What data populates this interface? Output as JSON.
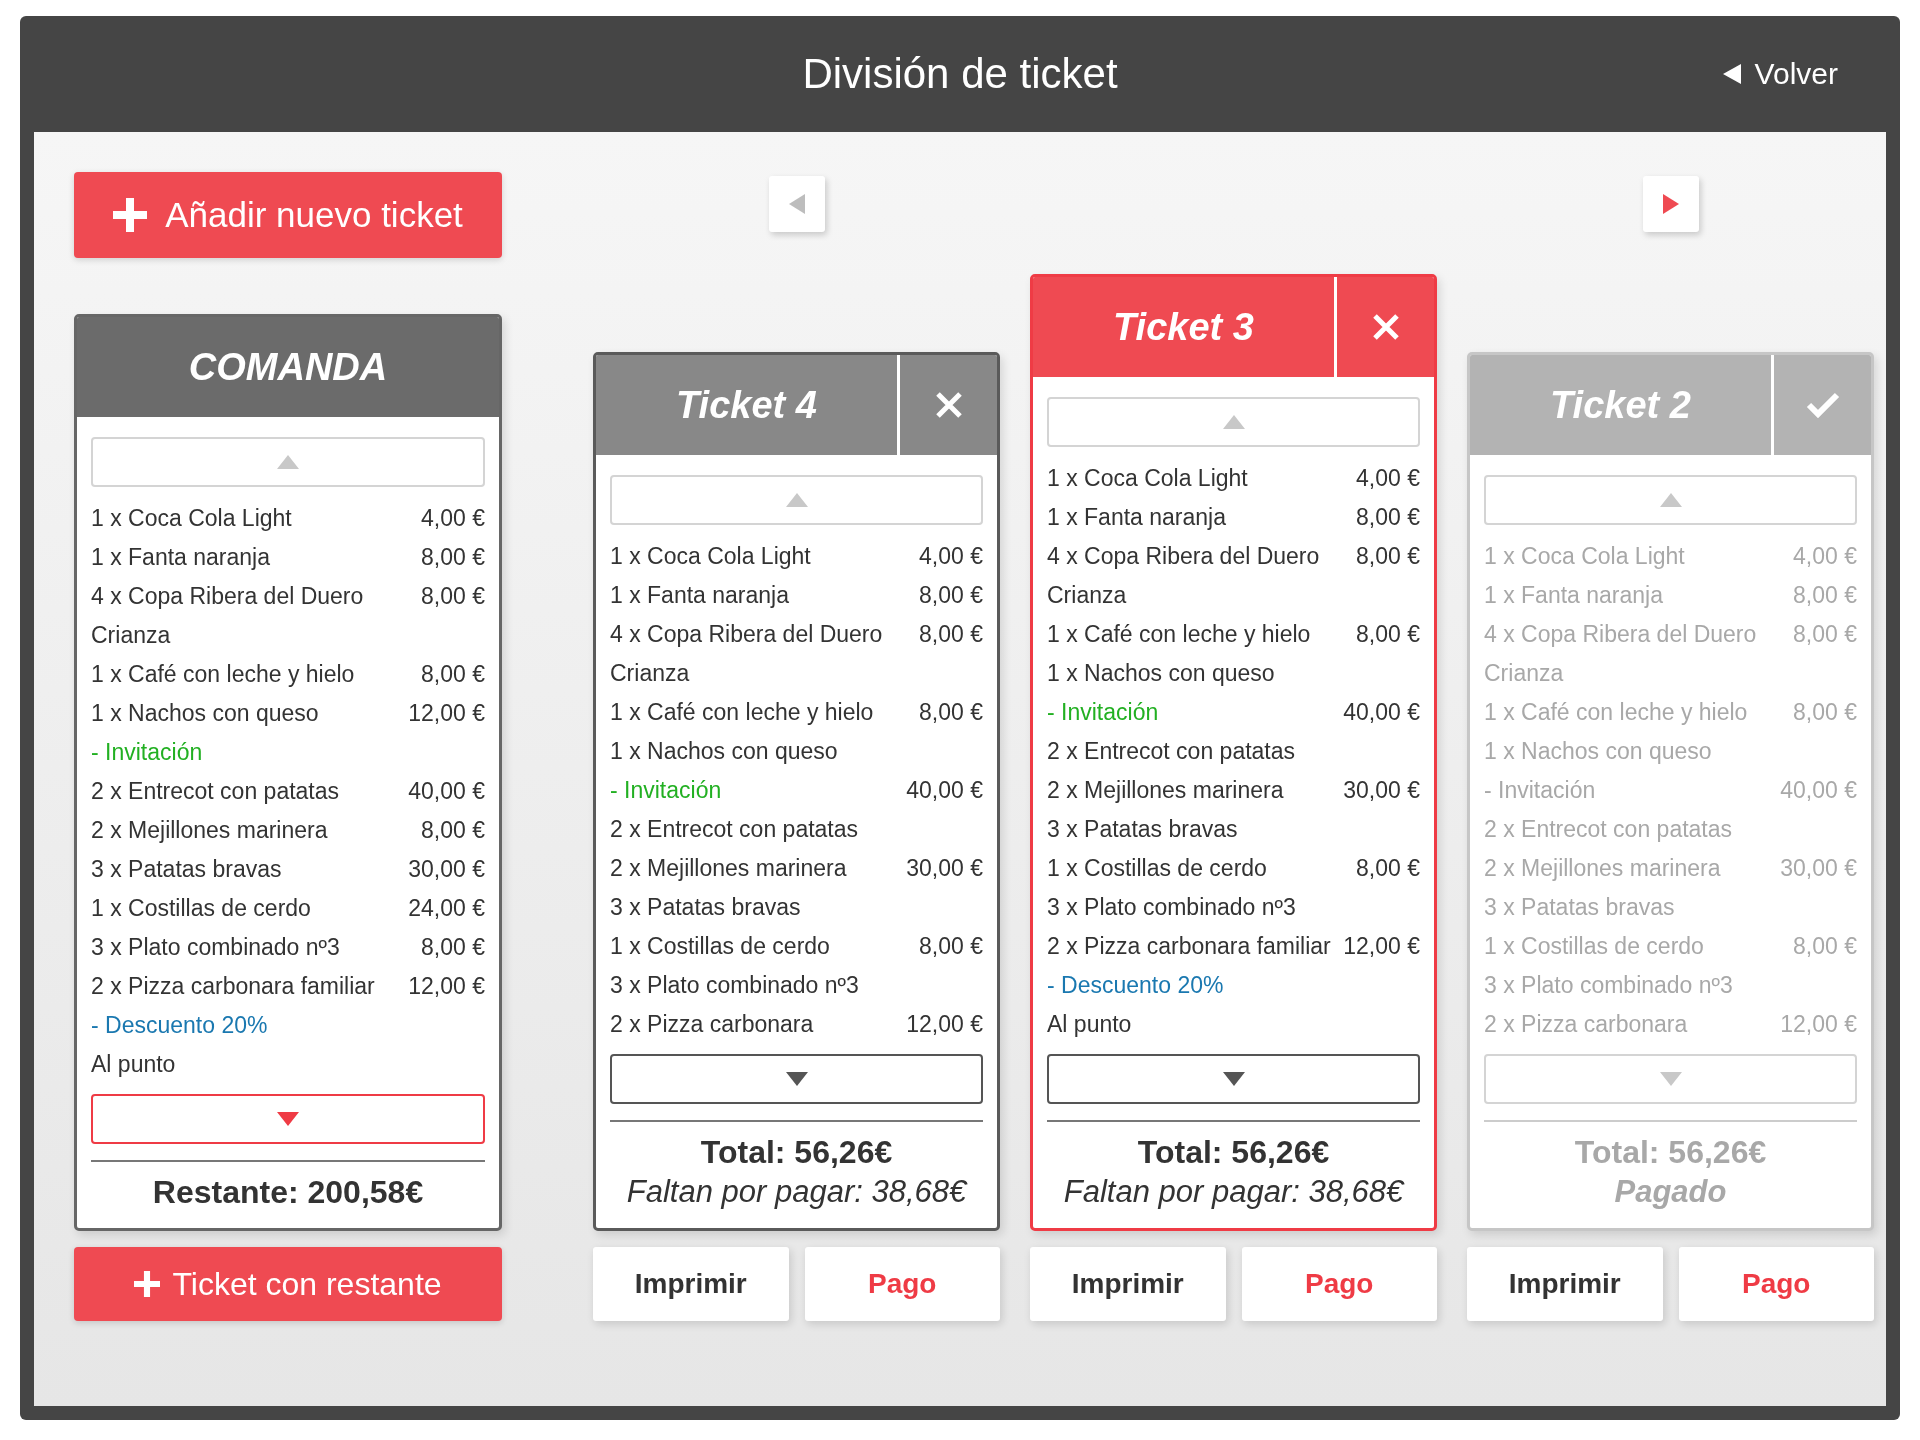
{
  "header": {
    "title": "División de ticket",
    "back_label": "Volver"
  },
  "add_ticket_label": "Añadir nuevo ticket",
  "pager": {
    "previous_enabled": false,
    "next_enabled": true
  },
  "comanda": {
    "title": "COMANDA",
    "scroll_down_highlighted": true,
    "footer": "Restante: 200,58€",
    "bottom_button": "Ticket con restante",
    "items": [
      {
        "text": "1 x Coca Cola Light",
        "price": "4,00 €",
        "kind": "product"
      },
      {
        "text": "1 x Fanta naranja",
        "price": "8,00 €",
        "kind": "product"
      },
      {
        "text": "4 x Copa Ribera del Duero Crianza",
        "price": "8,00 €",
        "kind": "product"
      },
      {
        "text": "1 x Café con leche y hielo",
        "price": "8,00 €",
        "kind": "product"
      },
      {
        "text": "1 x Nachos con queso",
        "price": "12,00 €",
        "kind": "product"
      },
      {
        "text": "- Invitación",
        "kind": "invitation"
      },
      {
        "text": "2 x Entrecot con patatas",
        "price": "40,00 €",
        "kind": "product"
      },
      {
        "text": "2 x Mejillones marinera",
        "price": "8,00 €",
        "kind": "product"
      },
      {
        "text": "3 x Patatas bravas",
        "price": "30,00 €",
        "kind": "product"
      },
      {
        "text": "1 x Costillas de cerdo",
        "price": "24,00 €",
        "kind": "product"
      },
      {
        "text": "3 x Plato combinado nº3",
        "price": "8,00 €",
        "kind": "product"
      },
      {
        "text": "2 x Pizza carbonara familiar",
        "price": "12,00 €",
        "kind": "product"
      },
      {
        "text": "- Descuento 20%",
        "kind": "discount"
      },
      {
        "text": "Al punto",
        "kind": "note"
      }
    ]
  },
  "tickets": [
    {
      "title": "Ticket 4",
      "paid": false,
      "selected": false,
      "total": "Total: 56,26€",
      "balance": "Faltan por pagar: 38,68€",
      "actions": [
        {
          "label": "Imprimir",
          "kind": "print"
        },
        {
          "label": "Pago",
          "kind": "pay"
        }
      ],
      "items": [
        {
          "text": "1 x Coca Cola Light",
          "price": "4,00 €",
          "kind": "product"
        },
        {
          "text": "1 x Fanta naranja",
          "price": "8,00 €",
          "kind": "product"
        },
        {
          "text": "4 x Copa Ribera del Duero Crianza",
          "price": "8,00 €",
          "kind": "product"
        },
        {
          "text": "1 x Café con leche y hielo",
          "price": "8,00 €",
          "kind": "product"
        },
        {
          "text": "1 x Nachos con queso",
          "kind": "product"
        },
        {
          "text": "- Invitación",
          "price": "40,00 €",
          "kind": "invitation"
        },
        {
          "text": "2 x Entrecot con patatas",
          "kind": "product"
        },
        {
          "text": "2 x Mejillones marinera",
          "price": "30,00 €",
          "kind": "product"
        },
        {
          "text": "3 x Patatas bravas",
          "kind": "product"
        },
        {
          "text": "1 x Costillas de cerdo",
          "price": "8,00 €",
          "kind": "product"
        },
        {
          "text": "3 x Plato combinado nº3",
          "kind": "product"
        },
        {
          "text": "2 x Pizza carbonara",
          "price": "12,00 €",
          "kind": "product"
        }
      ]
    },
    {
      "title": "Ticket 3",
      "paid": false,
      "selected": true,
      "total": "Total: 56,26€",
      "balance": "Faltan por pagar: 38,68€",
      "actions": [
        {
          "label": "Imprimir",
          "kind": "print"
        },
        {
          "label": "Pago",
          "kind": "pay"
        }
      ],
      "items": [
        {
          "text": "1 x Coca Cola Light",
          "price": "4,00 €",
          "kind": "product"
        },
        {
          "text": "1 x Fanta naranja",
          "price": "8,00 €",
          "kind": "product"
        },
        {
          "text": "4 x Copa Ribera del Duero Crianza",
          "price": "8,00 €",
          "kind": "product"
        },
        {
          "text": "1 x Café con leche y hielo",
          "price": "8,00 €",
          "kind": "product"
        },
        {
          "text": "1 x Nachos con queso",
          "kind": "product"
        },
        {
          "text": "- Invitación",
          "price": "40,00 €",
          "kind": "invitation"
        },
        {
          "text": "2 x Entrecot con patatas",
          "kind": "product"
        },
        {
          "text": "2 x Mejillones marinera",
          "price": "30,00 €",
          "kind": "product"
        },
        {
          "text": "3 x Patatas bravas",
          "kind": "product"
        },
        {
          "text": "1 x Costillas de cerdo",
          "price": "8,00 €",
          "kind": "product"
        },
        {
          "text": "3 x Plato combinado nº3",
          "kind": "product"
        },
        {
          "text": "2 x Pizza carbonara familiar",
          "price": "12,00 €",
          "kind": "product"
        },
        {
          "text": "- Descuento 20%",
          "kind": "discount"
        },
        {
          "text": "Al punto",
          "kind": "note"
        }
      ]
    },
    {
      "title": "Ticket 2",
      "paid": true,
      "selected": false,
      "total": "Total: 56,26€",
      "balance": "Pagado",
      "actions": [
        {
          "label": "Imprimir",
          "kind": "print"
        },
        {
          "label": "Pago",
          "kind": "pay"
        }
      ],
      "items": [
        {
          "text": "1 x Coca Cola Light",
          "price": "4,00 €",
          "kind": "product"
        },
        {
          "text": "1 x Fanta naranja",
          "price": "8,00 €",
          "kind": "product"
        },
        {
          "text": "4 x Copa Ribera del Duero Crianza",
          "price": "8,00 €",
          "kind": "product"
        },
        {
          "text": "1 x Café con leche y hielo",
          "price": "8,00 €",
          "kind": "product"
        },
        {
          "text": "1 x Nachos con queso",
          "kind": "product"
        },
        {
          "text": "- Invitación",
          "price": "40,00 €",
          "kind": "invitation"
        },
        {
          "text": "2 x Entrecot con patatas",
          "kind": "product"
        },
        {
          "text": "2 x Mejillones marinera",
          "price": "30,00 €",
          "kind": "product"
        },
        {
          "text": "3 x Patatas bravas",
          "kind": "product"
        },
        {
          "text": "1 x Costillas de cerdo",
          "price": "8,00 €",
          "kind": "product"
        },
        {
          "text": "3 x Plato combinado nº3",
          "kind": "product"
        },
        {
          "text": "2 x Pizza carbonara",
          "price": "12,00 €",
          "kind": "product"
        }
      ]
    }
  ]
}
